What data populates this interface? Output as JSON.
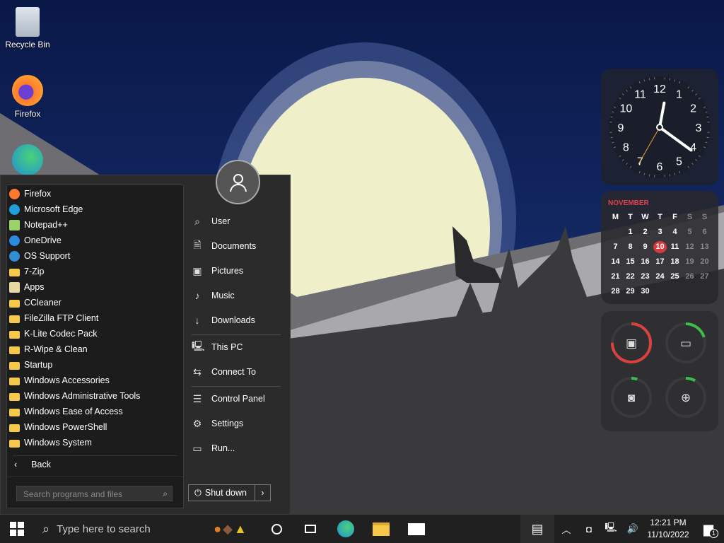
{
  "desktop": {
    "icons": [
      {
        "label": "Recycle Bin"
      },
      {
        "label": "Firefox"
      }
    ]
  },
  "start_menu": {
    "programs": [
      {
        "label": "Firefox",
        "icon": "firefox-icon",
        "color": "#ff7a2f"
      },
      {
        "label": "Microsoft Edge",
        "icon": "edge-icon",
        "color": "#1fa0d8"
      },
      {
        "label": "Notepad++",
        "icon": "notepad-icon",
        "color": "#9bd36b"
      },
      {
        "label": "OneDrive",
        "icon": "onedrive-icon",
        "color": "#2a8be0"
      },
      {
        "label": "OS Support",
        "icon": "globe-icon",
        "color": "#2f8fd3"
      },
      {
        "label": "7-Zip",
        "icon": "folder-icon"
      },
      {
        "label": "Apps",
        "icon": "apps-icon",
        "color": "#e8d9a0"
      },
      {
        "label": "CCleaner",
        "icon": "folder-icon"
      },
      {
        "label": "FileZilla FTP Client",
        "icon": "folder-icon"
      },
      {
        "label": "K-Lite Codec Pack",
        "icon": "folder-icon"
      },
      {
        "label": "R-Wipe & Clean",
        "icon": "folder-icon"
      },
      {
        "label": "Startup",
        "icon": "folder-icon"
      },
      {
        "label": "Windows Accessories",
        "icon": "folder-icon"
      },
      {
        "label": "Windows Administrative Tools",
        "icon": "folder-icon"
      },
      {
        "label": "Windows Ease of Access",
        "icon": "folder-icon"
      },
      {
        "label": "Windows PowerShell",
        "icon": "folder-icon"
      },
      {
        "label": "Windows System",
        "icon": "folder-icon"
      }
    ],
    "back_label": "Back",
    "search_placeholder": "Search programs and files",
    "right_items": [
      {
        "label": "User",
        "glyph": "⌕"
      },
      {
        "label": "Documents",
        "glyph": "🗎"
      },
      {
        "label": "Pictures",
        "glyph": "▣"
      },
      {
        "label": "Music",
        "glyph": "♪"
      },
      {
        "label": "Downloads",
        "glyph": "↓"
      },
      {
        "label": "This PC",
        "glyph": "🖳"
      },
      {
        "label": "Connect To",
        "glyph": "⇆"
      },
      {
        "label": "Control Panel",
        "glyph": "☰"
      },
      {
        "label": "Settings",
        "glyph": "⚙"
      },
      {
        "label": "Run...",
        "glyph": "▭"
      }
    ],
    "shutdown_label": "Shut down"
  },
  "widgets": {
    "clock": {
      "hour": 12,
      "minute": 21,
      "second": 35,
      "numbers": [
        "12",
        "1",
        "2",
        "3",
        "4",
        "5",
        "6",
        "7",
        "8",
        "9",
        "10",
        "11"
      ]
    },
    "calendar": {
      "month": "NOVEMBER",
      "weekdays": [
        "M",
        "T",
        "W",
        "T",
        "F",
        "S",
        "S"
      ],
      "start_offset": 1,
      "days": 30,
      "today": 10
    },
    "gauges": [
      {
        "name": "cpu",
        "percent": 75,
        "color": "#d9433f"
      },
      {
        "name": "memory",
        "percent": 20,
        "color": "#3cbf4a"
      },
      {
        "name": "disk",
        "percent": 5,
        "color": "#3cbf4a"
      },
      {
        "name": "network",
        "percent": 8,
        "color": "#3cbf4a"
      }
    ]
  },
  "taskbar": {
    "search_placeholder": "Type here to search",
    "time": "12:21 PM",
    "date": "11/10/2022",
    "notification_count": "1"
  }
}
